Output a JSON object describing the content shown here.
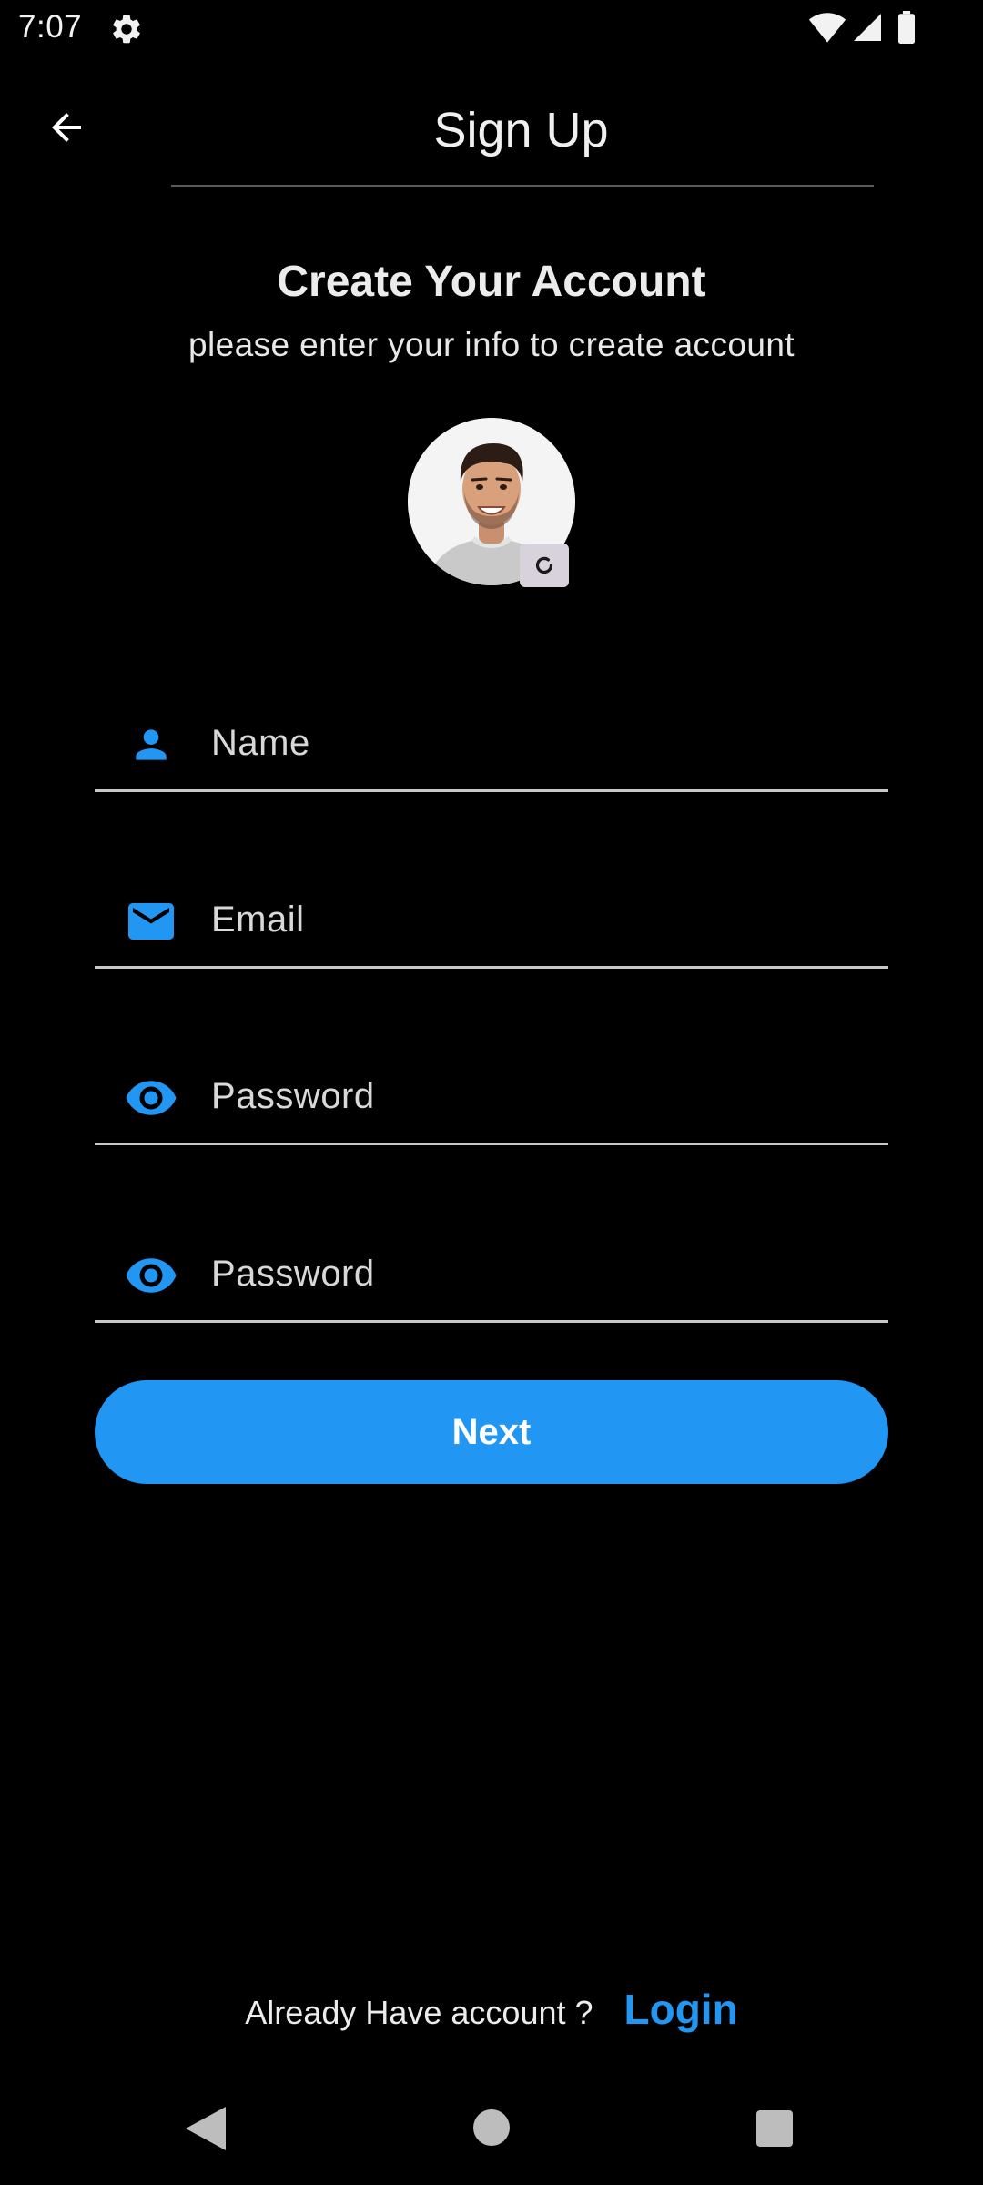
{
  "status_bar": {
    "time": "7:07",
    "icons": [
      "gear-icon",
      "wifi-icon",
      "signal-icon",
      "battery-icon"
    ]
  },
  "app_bar": {
    "title": "Sign Up",
    "back_icon": "arrow-left-icon"
  },
  "header": {
    "title": "Create Your Account",
    "subtitle": "please enter your info to create account"
  },
  "avatar": {
    "edit_icon": "refresh-icon"
  },
  "form": {
    "fields": [
      {
        "icon": "person-icon",
        "placeholder": "Name"
      },
      {
        "icon": "mail-icon",
        "placeholder": "Email"
      },
      {
        "icon": "eye-icon",
        "placeholder": "Password"
      },
      {
        "icon": "eye-icon",
        "placeholder": "Password"
      }
    ],
    "submit_label": "Next"
  },
  "footer": {
    "prompt": "Already Have account ?",
    "link_label": "Login"
  },
  "colors": {
    "accent": "#2196f3",
    "background": "#000000",
    "text": "#e6e6e6"
  }
}
